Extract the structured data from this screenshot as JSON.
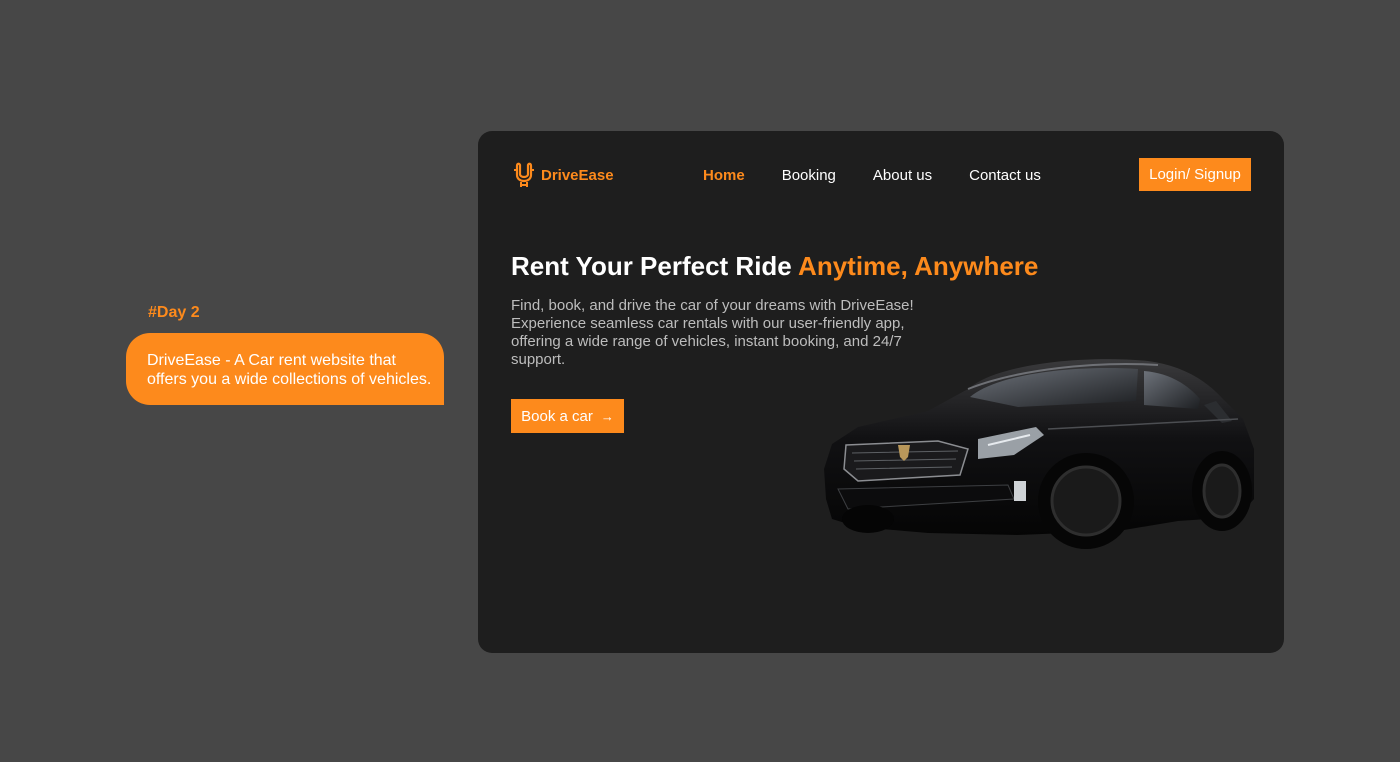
{
  "annotation": {
    "day_tag": "#Day 2",
    "description": "DriveEase - A Car rent website that offers you a wide collections of vehicles."
  },
  "site": {
    "brand": "DriveEase",
    "nav": [
      {
        "label": "Home",
        "active": true
      },
      {
        "label": "Booking",
        "active": false
      },
      {
        "label": "About us",
        "active": false
      },
      {
        "label": "Contact us",
        "active": false
      }
    ],
    "login_label": "Login/ Signup",
    "hero": {
      "title_main": "Rent Your Perfect Ride",
      "title_accent": "Anytime, Anywhere",
      "description": "Find, book, and drive the car of your dreams with DriveEase! Experience seamless car rentals with our user-friendly app, offering a wide range of vehicles, instant booking, and 24/7 support.",
      "cta_label": "Book a car",
      "cta_icon": "arrow-right-icon"
    }
  },
  "colors": {
    "accent": "#fd8a1c",
    "background": "#474747",
    "card": "#1e1e1e"
  }
}
